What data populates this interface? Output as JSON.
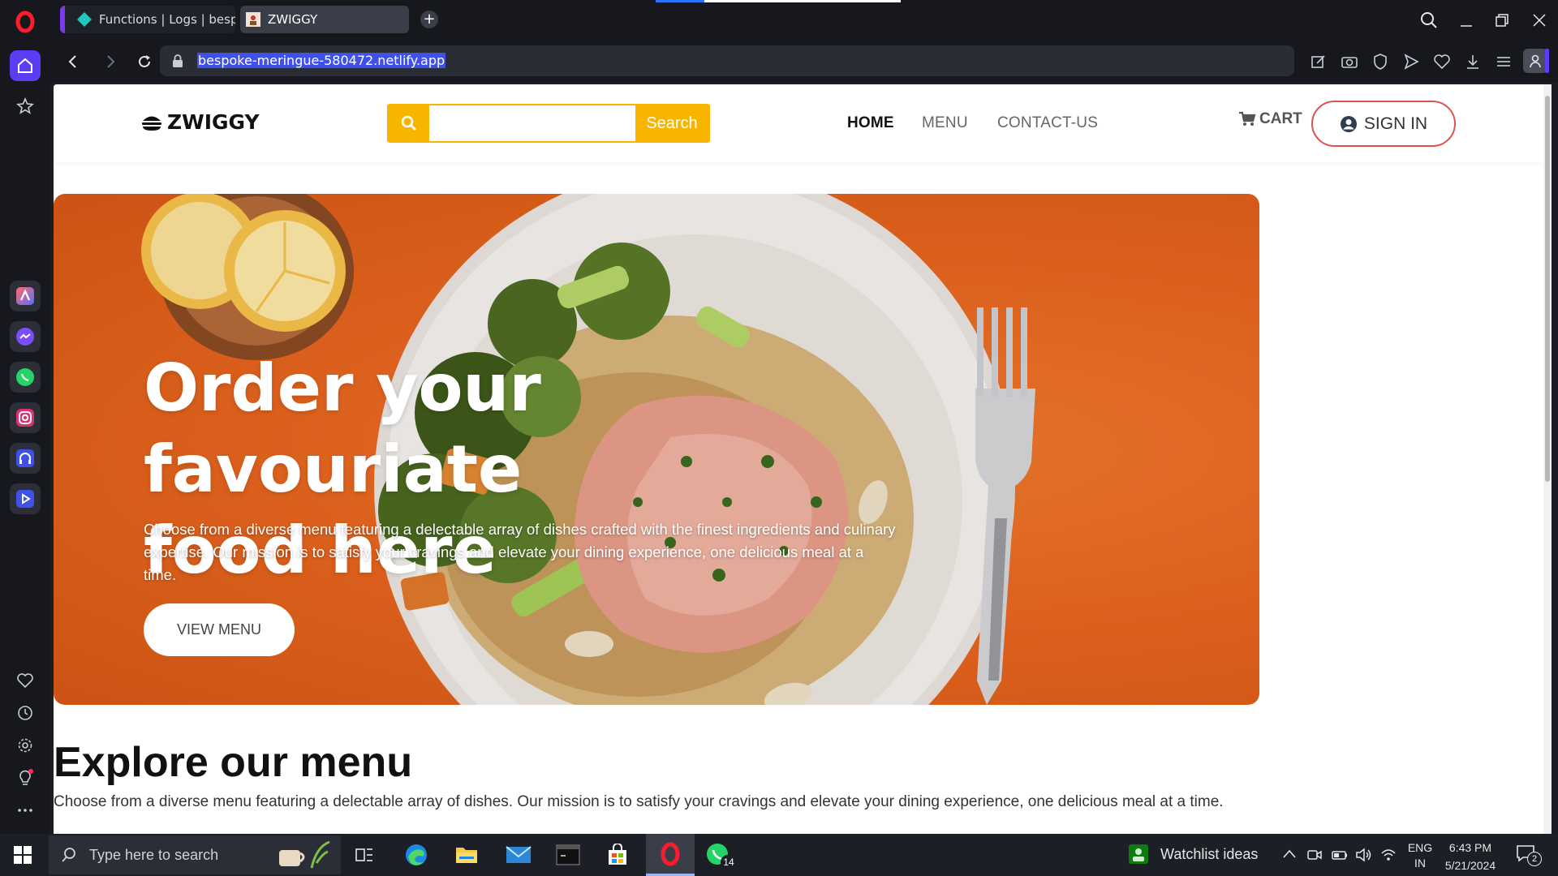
{
  "browser": {
    "tabs": [
      {
        "label": "Functions | Logs | bespoke"
      },
      {
        "label": "ZWIGGY"
      }
    ],
    "new_tab_label": "+",
    "url": "bespoke-meringue-580472.netlify.app"
  },
  "site": {
    "brand": "ZWIGGY",
    "search_placeholder": "",
    "search_button": "Search",
    "nav": [
      {
        "label": "HOME"
      },
      {
        "label": "MENU"
      },
      {
        "label": "CONTACT-US"
      }
    ],
    "cart_label": "CART",
    "signin_label": "SIGN IN",
    "colors": {
      "accent": "#f8b500",
      "hero_orange": "#e7651e",
      "signin_border": "#d9534f"
    }
  },
  "hero": {
    "title_line1": "Order your favouriate",
    "title_line2": "food here",
    "description": "Choose from a diverse menu featuring a delectable array of dishes crafted with the finest ingredients and culinary expertise. Our mission is to satisfy your cravings and elevate your dining experience, one delicious meal at a time.",
    "button": "VIEW MENU"
  },
  "explore": {
    "title": "Explore our menu",
    "description": "Choose from a diverse menu featuring a delectable array of dishes. Our mission is to satisfy your cravings and elevate your dining experience, one delicious meal at a time."
  },
  "taskbar": {
    "search_placeholder": "Type here to search",
    "whatsapp_badge": "14",
    "widget_label": "Watchlist ideas",
    "lang_line1": "ENG",
    "lang_line2": "IN",
    "time": "6:43 PM",
    "date": "5/21/2024",
    "notification_count": "2"
  }
}
